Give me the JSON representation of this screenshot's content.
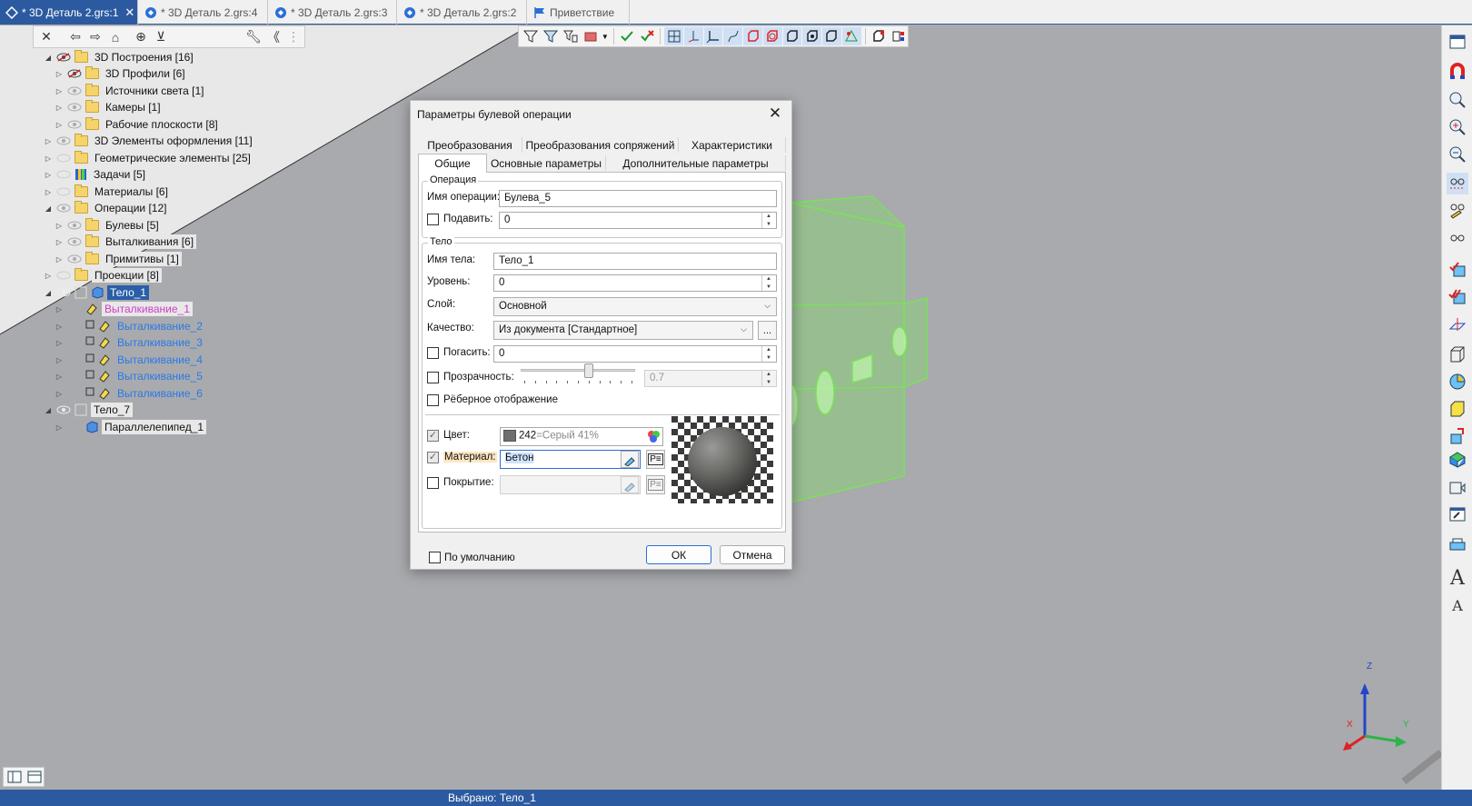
{
  "tabs": [
    {
      "label": "* 3D Деталь 2.grs:1",
      "active": true
    },
    {
      "label": "* 3D Деталь 2.grs:4",
      "active": false
    },
    {
      "label": "* 3D Деталь 2.grs:3",
      "active": false
    },
    {
      "label": "* 3D Деталь 2.grs:2",
      "active": false
    },
    {
      "label": "Приветствие",
      "active": false
    }
  ],
  "tree": [
    {
      "label": "3D Построения [16]"
    },
    {
      "label": "3D Профили [6]"
    },
    {
      "label": "Источники света [1]"
    },
    {
      "label": "Камеры [1]"
    },
    {
      "label": "Рабочие плоскости [8]"
    },
    {
      "label": "3D Элементы оформления [11]"
    },
    {
      "label": "Геометрические элементы [25]"
    },
    {
      "label": "Задачи [5]"
    },
    {
      "label": "Материалы [6]"
    },
    {
      "label": "Операции [12]"
    },
    {
      "label": "Булевы [5]"
    },
    {
      "label": "Выталкивания [6]"
    },
    {
      "label": "Примитивы [1]"
    },
    {
      "label": "Проекции [8]"
    },
    {
      "label": "Тело_1"
    },
    {
      "label": "Выталкивание_1"
    },
    {
      "label": "Выталкивание_2"
    },
    {
      "label": "Выталкивание_3"
    },
    {
      "label": "Выталкивание_4"
    },
    {
      "label": "Выталкивание_5"
    },
    {
      "label": "Выталкивание_6"
    },
    {
      "label": "Тело_7"
    },
    {
      "label": "Параллелепипед_1"
    }
  ],
  "dialog": {
    "title": "Параметры булевой операции",
    "tabs_row1": [
      "Преобразования",
      "Преобразования сопряжений",
      "Характеристики"
    ],
    "tabs_row2": [
      "Общие",
      "Основные параметры",
      "Дополнительные параметры"
    ],
    "operation": {
      "group": "Операция",
      "name_label": "Имя операции:",
      "name_value": "Булева_5",
      "suppress_label": "Подавить:",
      "suppress_value": "0"
    },
    "body": {
      "group": "Тело",
      "name_label": "Имя тела:",
      "name_value": "Тело_1",
      "level_label": "Уровень:",
      "level_value": "0",
      "layer_label": "Слой:",
      "layer_value": "Основной",
      "quality_label": "Качество:",
      "quality_value": "Из документа [Стандартное]",
      "quality_more": "...",
      "hide_label": "Погасить:",
      "hide_value": "0",
      "transparency_label": "Прозрачность:",
      "transparency_value": "0.7",
      "transparency_level": 0.6,
      "edge_label": "Рёберное отображение",
      "color_label": "Цвет:",
      "color_value": "242",
      "color_name": "=Серый 41%",
      "color_hex": "#6e6e6e",
      "material_label": "Материал:",
      "material_value": "Бетон",
      "coating_label": "Покрытие:"
    },
    "default_label": "По умолчанию",
    "ok": "ОК",
    "cancel": "Отмена"
  },
  "status": "Выбрано: Тело_1",
  "axes": {
    "x": "X",
    "y": "Y",
    "z": "Z"
  },
  "colors": {
    "accent": "#2c5aa0",
    "selection": "#2a5ea8",
    "model_green": "#79e25a",
    "link_blue": "#2a7ae2"
  }
}
